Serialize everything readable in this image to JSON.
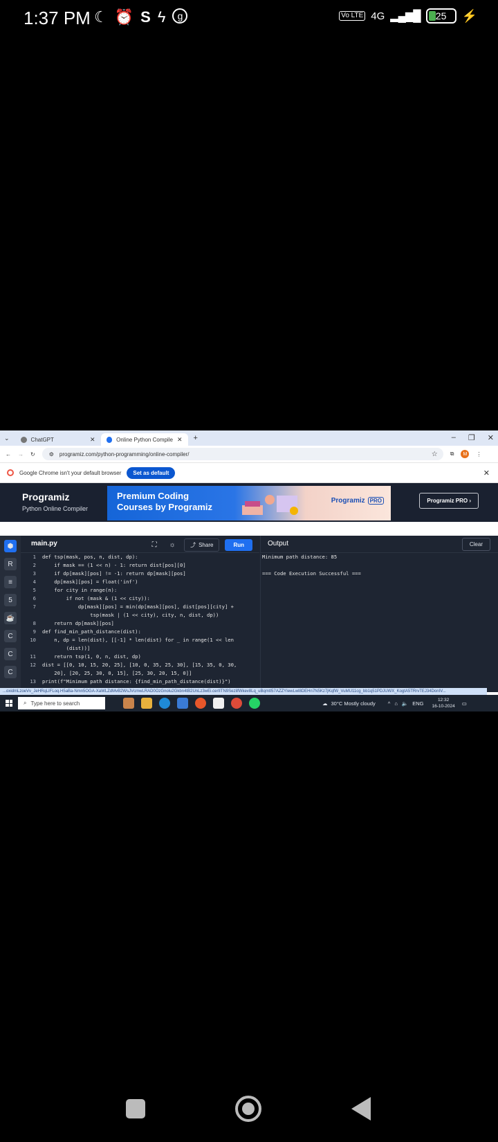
{
  "phone_status": {
    "time": "1:37 PM",
    "icons": [
      "moon-icon",
      "alarm-icon",
      "s-app-icon",
      "shazam-icon",
      "g-app-icon"
    ],
    "network_badge": "Vo LTE",
    "network": "4G",
    "battery_level": "25"
  },
  "browser": {
    "tabs": [
      {
        "label": "ChatGPT",
        "active": false
      },
      {
        "label": "Online Python Compiler (Inter",
        "active": true
      }
    ],
    "new_tab": "+",
    "url": "programiz.com/python-programming/online-compiler/",
    "profile_initial": "M",
    "default_banner": {
      "message": "Google Chrome isn't your default browser",
      "button": "Set as default"
    }
  },
  "site": {
    "logo": "Programiz",
    "subtitle": "Python Online Compiler",
    "ad": {
      "text": "Premium Coding Courses by Programiz",
      "brand": "Programiz",
      "brand_tag": "PRO"
    },
    "pro_button": "Programiz PRO ›"
  },
  "editor": {
    "filename": "main.py",
    "share_label": "Share",
    "run_label": "Run",
    "lines": [
      {
        "n": "1",
        "code": "def tsp(mask, pos, n, dist, dp):"
      },
      {
        "n": "2",
        "code": "    if mask == (1 << n) - 1: return dist[pos][0]"
      },
      {
        "n": "3",
        "code": "    if dp[mask][pos] != -1: return dp[mask][pos]"
      },
      {
        "n": "4",
        "code": "    dp[mask][pos] = float('inf')"
      },
      {
        "n": "5",
        "code": "    for city in range(n):"
      },
      {
        "n": "6",
        "code": "        if not (mask & (1 << city)):"
      },
      {
        "n": "7",
        "code": "            dp[mask][pos] = min(dp[mask][pos], dist[pos][city] +"
      },
      {
        "n": "",
        "code": "                tsp(mask | (1 << city), city, n, dist, dp))"
      },
      {
        "n": "8",
        "code": "    return dp[mask][pos]"
      },
      {
        "n": "9",
        "code": "def find_min_path_distance(dist):"
      },
      {
        "n": "10",
        "code": "    n, dp = len(dist), [[-1] * len(dist) for _ in range(1 << len"
      },
      {
        "n": "",
        "code": "        (dist))]"
      },
      {
        "n": "11",
        "code": "    return tsp(1, 0, n, dist, dp)"
      },
      {
        "n": "12",
        "code": "dist = [[0, 10, 15, 20, 25], [10, 0, 35, 25, 30], [15, 35, 0, 30,"
      },
      {
        "n": "",
        "code": "    20], [20, 25, 30, 0, 15], [25, 30, 20, 15, 0]]"
      },
      {
        "n": "13",
        "code": "print(f\"Minimum path distance: {find_min_path_distance(dist)}\")"
      }
    ]
  },
  "output": {
    "title": "Output",
    "clear_label": "Clear",
    "lines": [
      "Minimum path distance: 85",
      "",
      "=== Code Execution Successful ==="
    ]
  },
  "status_url": "...oxidmLzoeVv_JeHRqLIFLoq.H5aBa-Nmn5OGA-XaWLZdMvB2WsJVcmwLRAD0OzGnolu2Gkbn4tB2UnLz3wEi.cerIITN9SezlifWkev8Lq_uBqmtI57AZZYIewLwl8DEHn7N5Kz7jKqfW_VuMU11cg_bb1q51PDJUWX_KogtA5TRrvTEJ34DonIV...",
  "taskbar": {
    "search_placeholder": "Type here to search",
    "weather": "30°C  Mostly cloudy",
    "language": "ENG",
    "time": "12:32",
    "date": "16-10-2024"
  }
}
